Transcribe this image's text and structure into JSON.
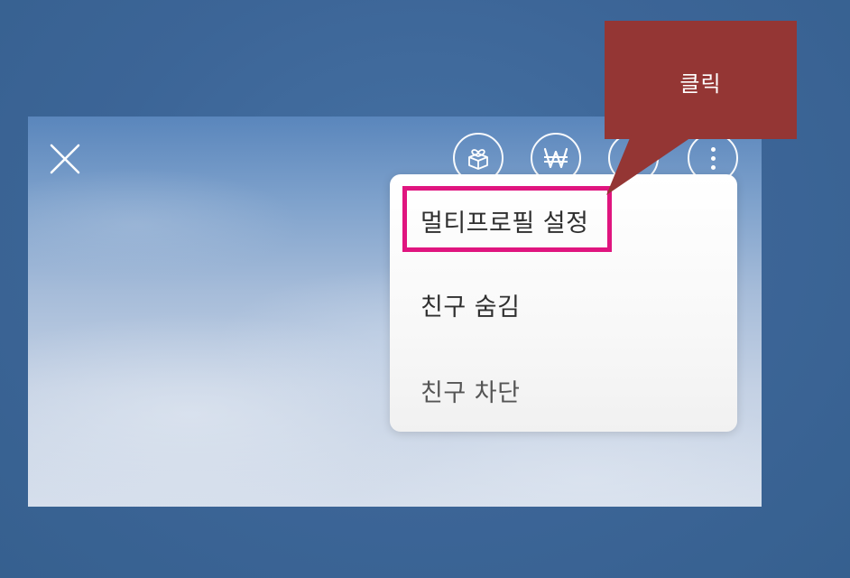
{
  "menu": {
    "items": [
      {
        "label": "멀티프로필 설정"
      },
      {
        "label": "친구 숨김"
      },
      {
        "label": "친구 차단"
      }
    ]
  },
  "callout": {
    "text": "클릭"
  },
  "icons": {
    "close": "close-icon",
    "gift": "gift-box-icon",
    "won": "won-currency-icon",
    "third": "partially-hidden-icon",
    "more": "more-vertical-icon"
  },
  "colors": {
    "highlight": "#e0157f",
    "callout": "#943634",
    "backdrop": "#3d6699"
  }
}
